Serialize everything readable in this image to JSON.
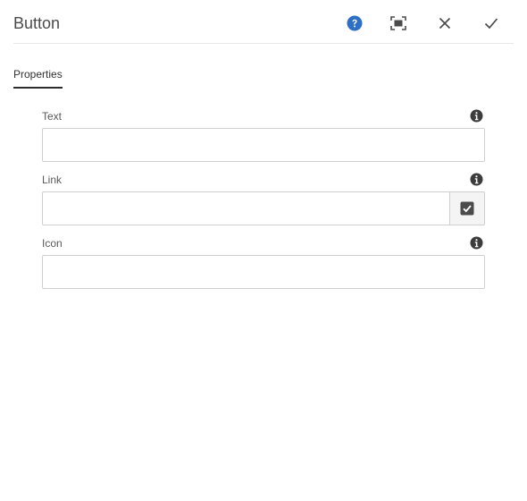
{
  "dialog": {
    "title": "Button",
    "actions": {
      "help": "help-icon",
      "fullscreen": "fullscreen-icon",
      "close": "close-icon",
      "done": "checkmark-icon"
    }
  },
  "tabs": [
    {
      "label": "Properties",
      "active": true
    }
  ],
  "fields": {
    "text": {
      "label": "Text",
      "value": "",
      "info_icon": "info-icon"
    },
    "link": {
      "label": "Link",
      "value": "",
      "info_icon": "info-icon",
      "picker_icon": "checkbox-checked-icon"
    },
    "icon": {
      "label": "Icon",
      "value": "",
      "info_icon": "info-icon"
    }
  },
  "colors": {
    "help_accent": "#2d6fc4",
    "icon_dark": "#3c3c3c",
    "border": "#d0d0d0"
  }
}
